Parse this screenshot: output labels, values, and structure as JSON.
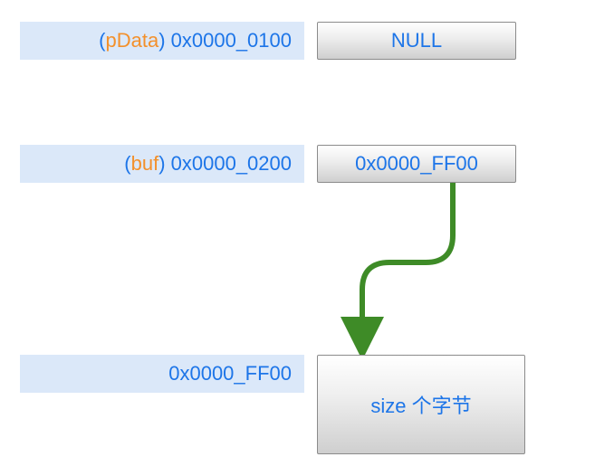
{
  "row1": {
    "var": "pData",
    "addr": "0x0000_0100",
    "value": "NULL"
  },
  "row2": {
    "var": "buf",
    "addr": "0x0000_0200",
    "value": "0x0000_FF00"
  },
  "row3": {
    "addr": "0x0000_FF00",
    "value": "size 个字节"
  }
}
